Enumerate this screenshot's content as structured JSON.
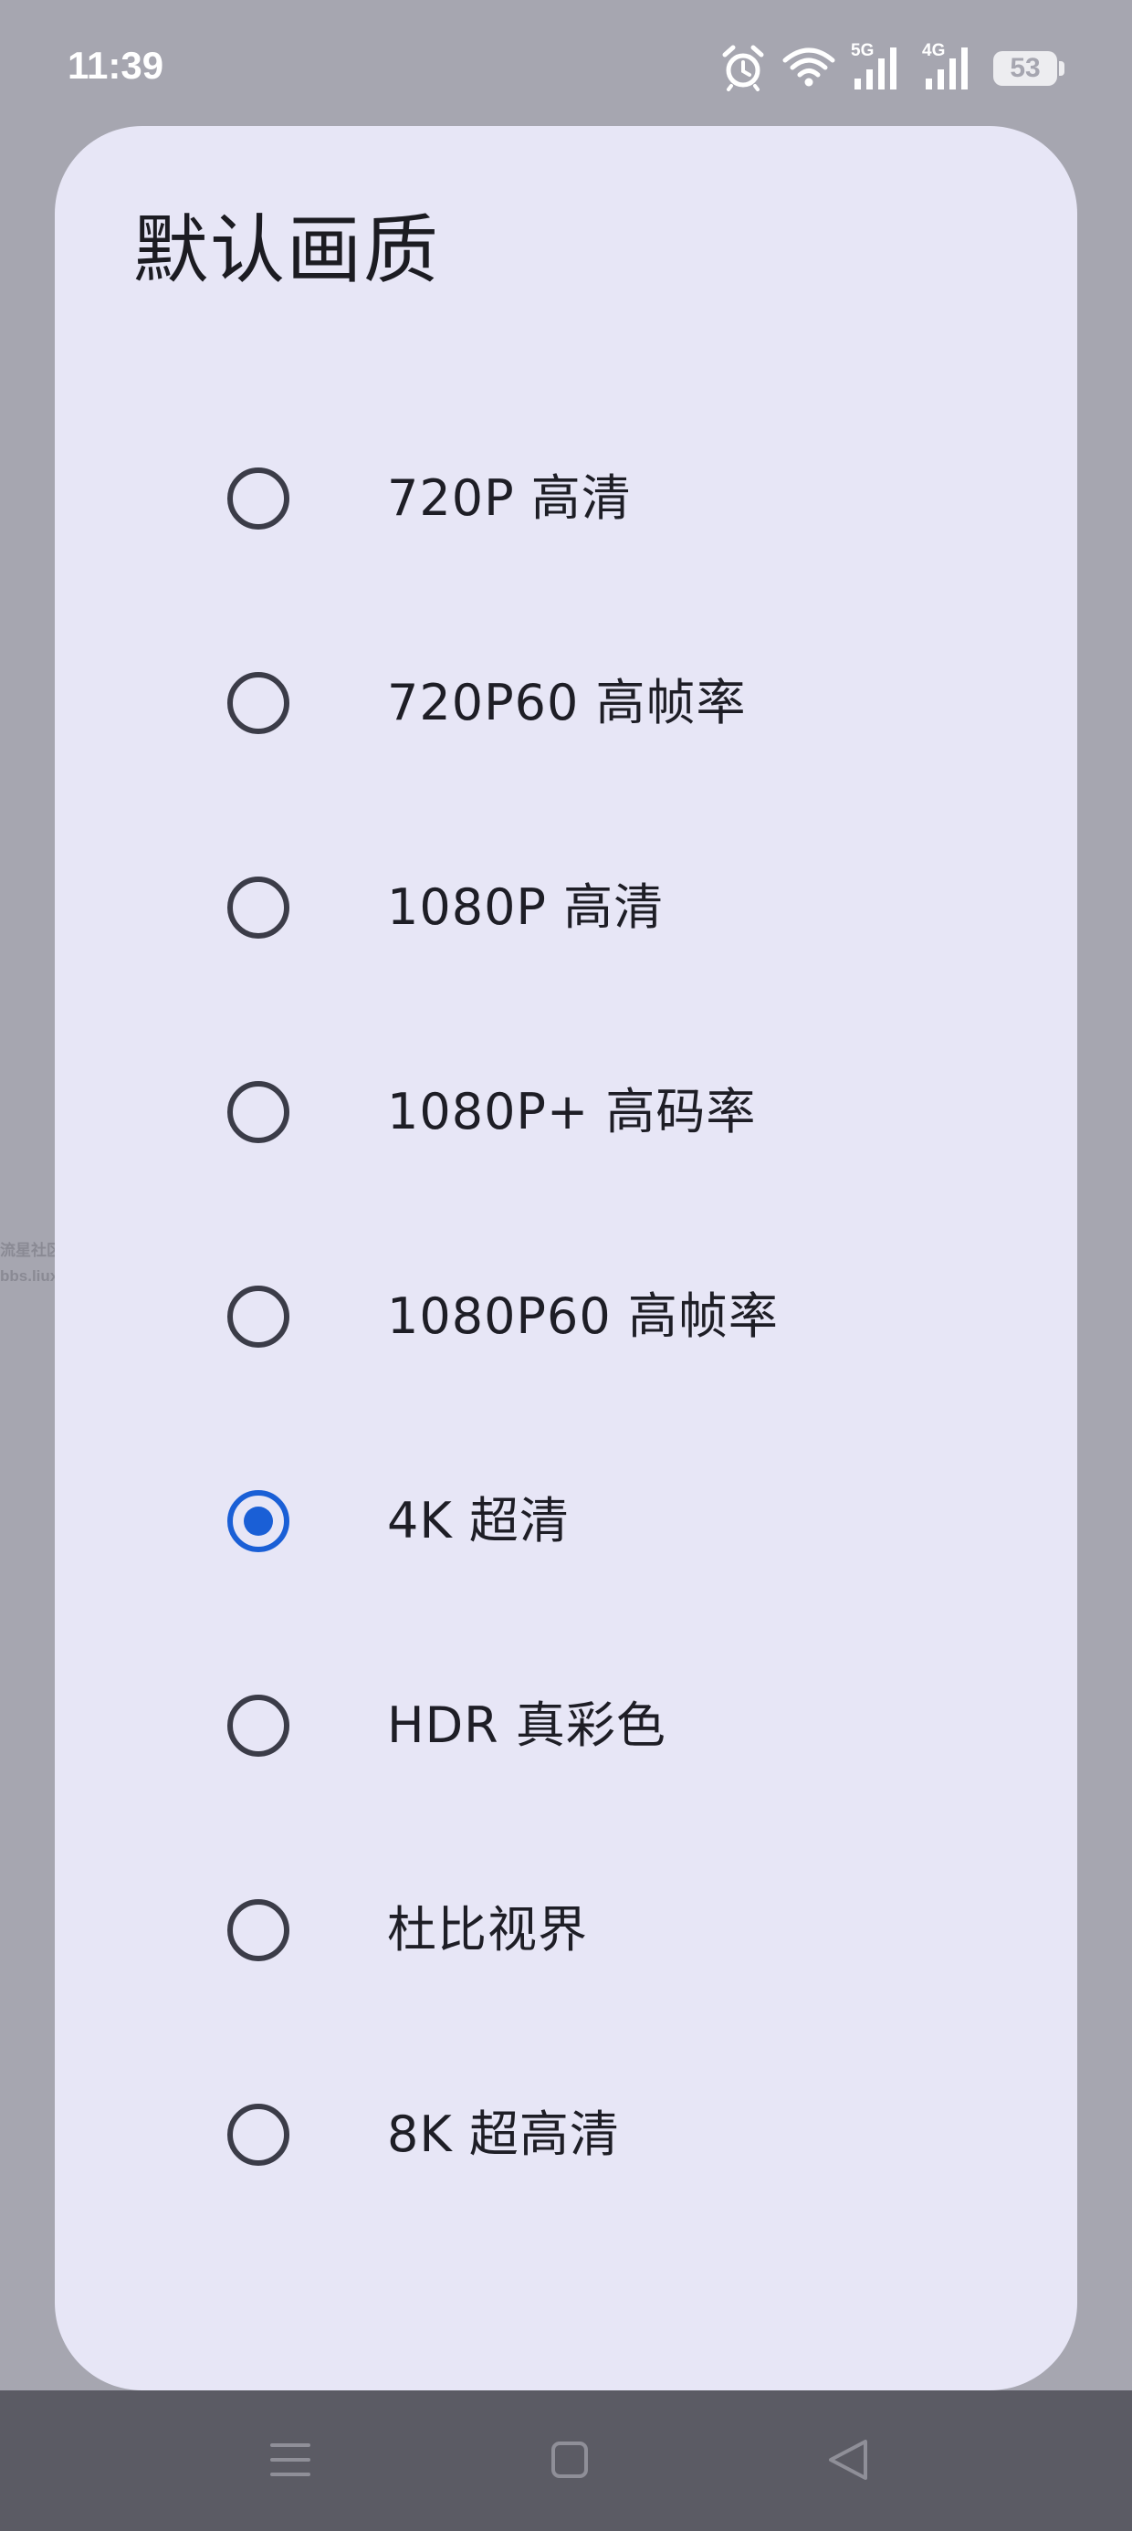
{
  "status_bar": {
    "time": "11:39",
    "icons": [
      "alarm-icon",
      "wifi-icon",
      "signal-5g-icon",
      "signal-4g-icon",
      "battery-icon"
    ],
    "network_labels": [
      "5G",
      "4G"
    ],
    "battery_level": "53"
  },
  "watermark": {
    "line1": "流星社区",
    "line2": "bbs.liuxingw.com"
  },
  "dialog": {
    "title": "默认画质",
    "selected_index": 5,
    "options": [
      {
        "label": "720P 高清",
        "checked": false
      },
      {
        "label": "720P60 高帧率",
        "checked": false
      },
      {
        "label": "1080P 高清",
        "checked": false
      },
      {
        "label": "1080P+ 高码率",
        "checked": false
      },
      {
        "label": "1080P60 高帧率",
        "checked": false
      },
      {
        "label": "4K 超清",
        "checked": true
      },
      {
        "label": "HDR 真彩色",
        "checked": false
      },
      {
        "label": "杜比视界",
        "checked": false
      },
      {
        "label": "8K 超高清",
        "checked": false
      }
    ]
  },
  "nav_bar": {
    "buttons": [
      "menu-icon",
      "home-icon",
      "back-icon"
    ]
  },
  "colors": {
    "scrim": "#a6a6b0",
    "dialog_background": "#e7e6f6",
    "radio_selected": "#1a5fd6",
    "radio_unselected": "#3b3c48",
    "nav_bar": "#5b5b64"
  }
}
